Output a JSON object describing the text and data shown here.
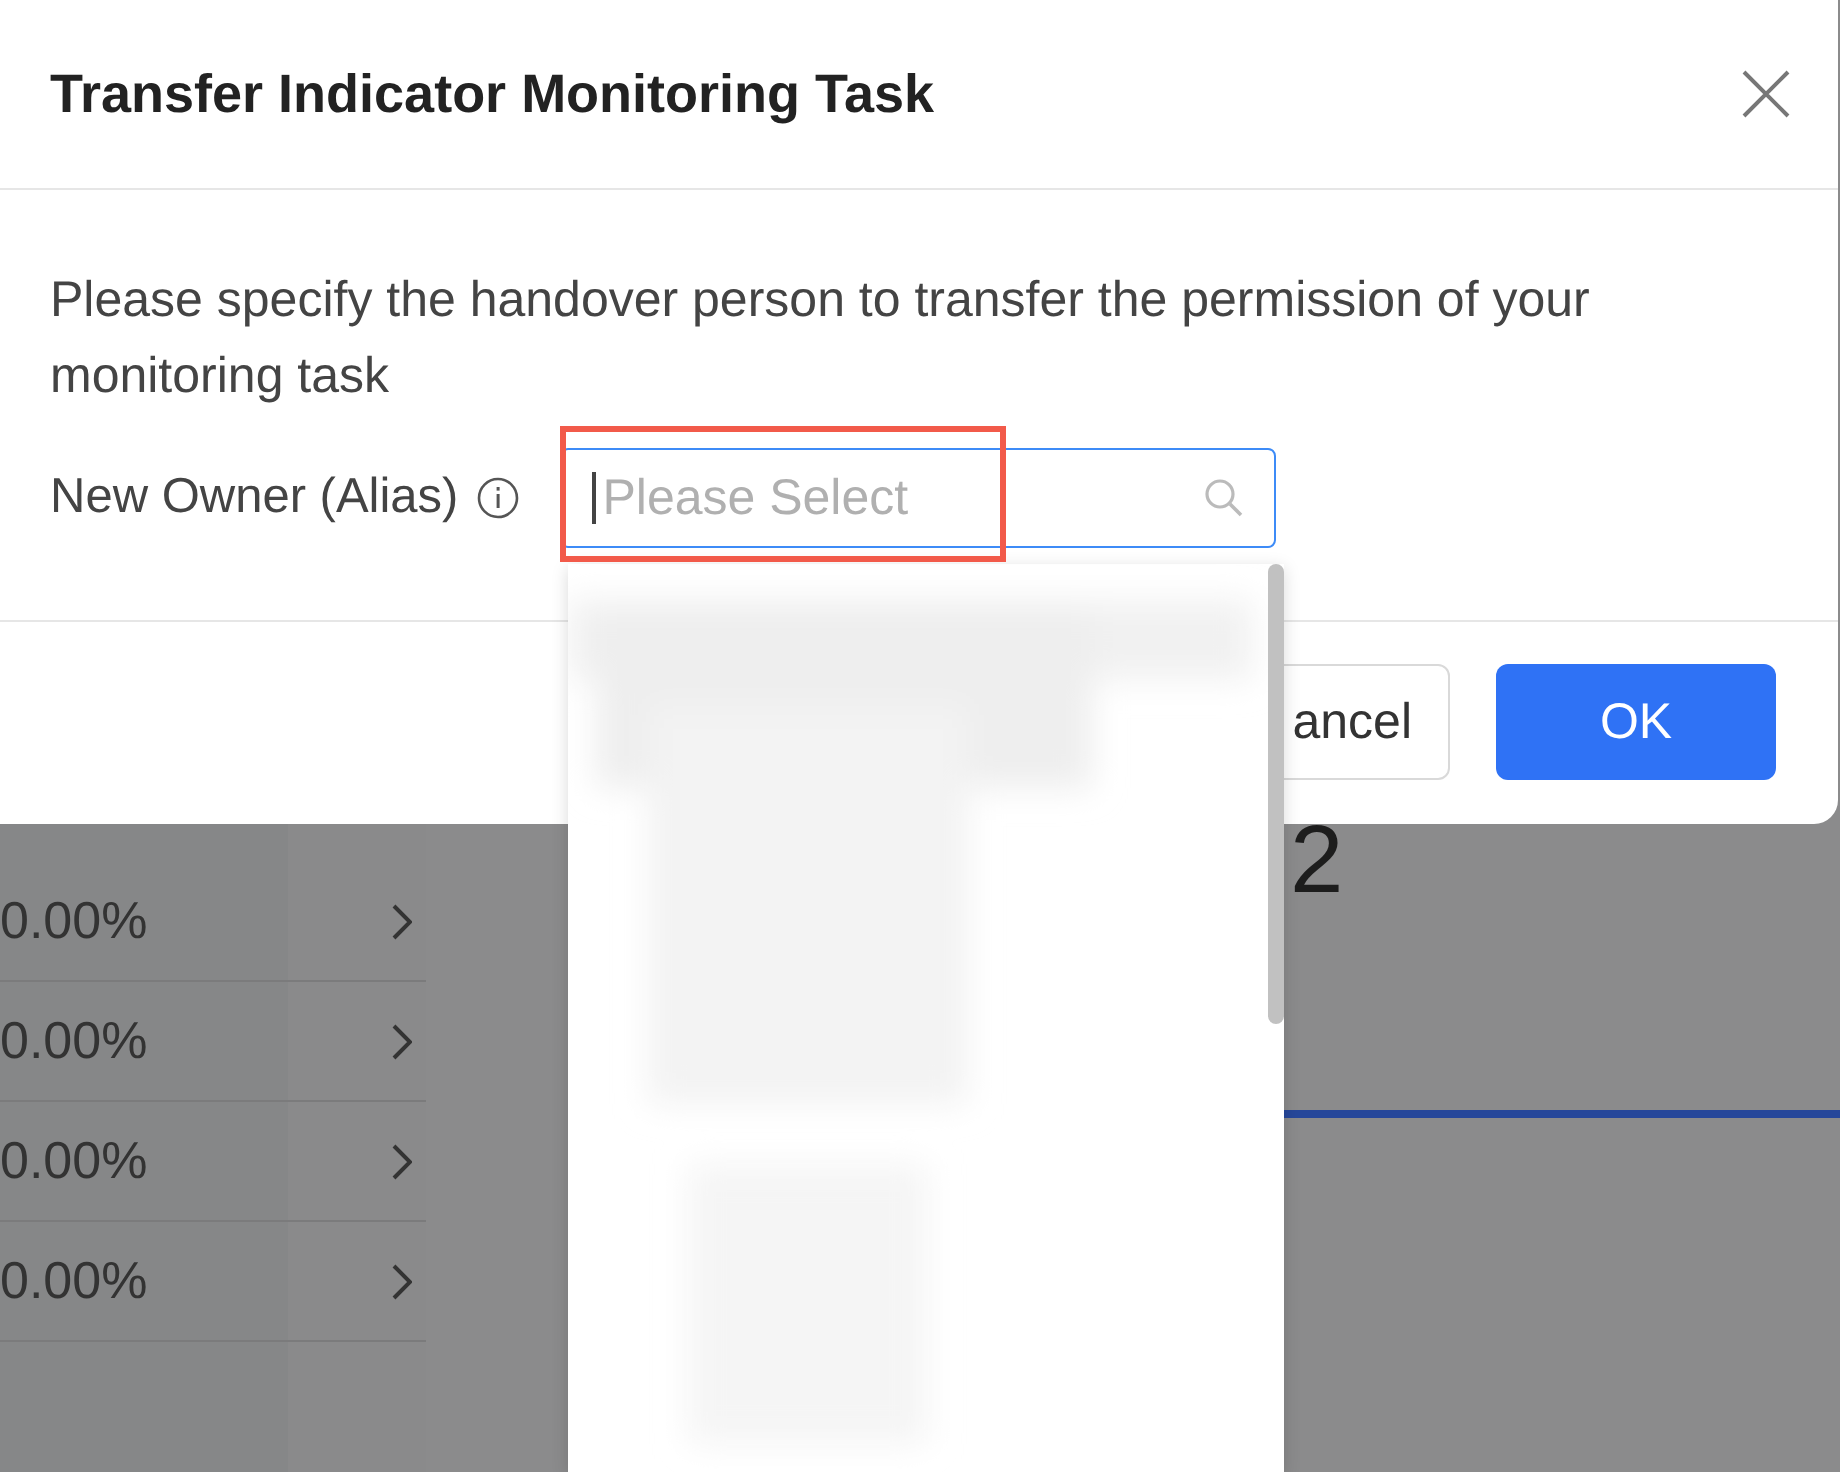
{
  "background": {
    "rows": [
      {
        "value": "0.00%"
      },
      {
        "value": "0.00%"
      },
      {
        "value": "0.00%"
      },
      {
        "value": "0.00%"
      }
    ],
    "chart": {
      "value": "2"
    }
  },
  "dialog": {
    "title": "Transfer Indicator Monitoring Task",
    "message": "Please specify the handover person to transfer the permission of your monitoring task",
    "field": {
      "label": "New Owner (Alias)",
      "placeholder": "Please Select",
      "focused": true
    },
    "dropdown": {
      "open": true
    },
    "buttons": [
      {
        "label": "ancel",
        "kind": "default"
      },
      {
        "label": "OK",
        "kind": "primary"
      }
    ]
  },
  "annotation": {
    "kind": "box"
  }
}
